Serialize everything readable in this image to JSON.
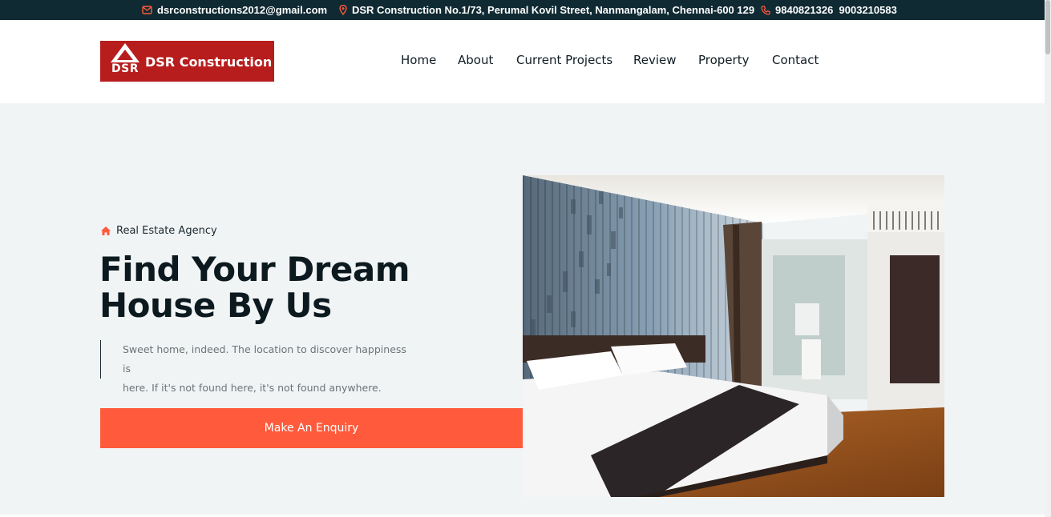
{
  "topbar": {
    "email": "dsrconstructions2012@gmail.com",
    "address": "DSR Construction No.1/73, Perumal Kovil Street, Nanmangalam, Chennai-600 129",
    "phones": "9840821326  9003210583",
    "icons": [
      "mail-icon",
      "location-pin-icon",
      "phone-icon"
    ],
    "background": "#102a33",
    "icon_color": "#ff5a3c"
  },
  "header": {
    "logo": {
      "mark_text": "DSR",
      "brand_text": "DSR Construction",
      "background": "#b81d1d"
    },
    "nav": [
      "Home",
      "About",
      "Current Projects",
      "Review",
      "Property",
      "Contact"
    ]
  },
  "hero": {
    "eyebrow": "Real Estate Agency",
    "eyebrow_icon": "home-icon",
    "title_line1": "Find Your Dream",
    "title_line2": "House By Us",
    "description_line1": "Sweet home, indeed. The location to discover happiness is",
    "description_line2": "here. If it's not found here, it's not found anywhere.",
    "button_label": "Make An Enquiry",
    "accent": "#ff5a3c",
    "background": "#f1f4f5"
  }
}
